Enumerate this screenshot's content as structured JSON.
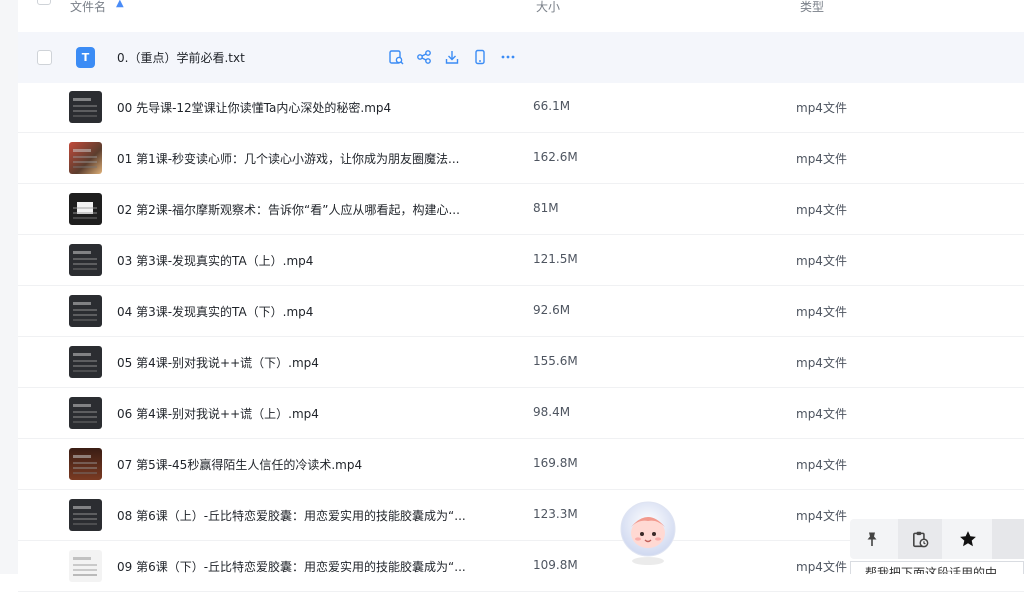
{
  "header": {
    "name_label": "文件名",
    "size_label": "大小",
    "type_label": "类型"
  },
  "highlighted_file": {
    "name": "0.（重点）学前必看.txt",
    "icon_letter": "T"
  },
  "rows": [
    {
      "name": "00 先导课-12堂课让你读懂Ta内心深处的秘密.mp4",
      "size": "66.1M",
      "type": "mp4文件"
    },
    {
      "name": "01 第1课-秒变读心师：几个读心小游戏，让你成为朋友圈魔法...",
      "size": "162.6M",
      "type": "mp4文件"
    },
    {
      "name": "02 第2课-福尔摩斯观察术：告诉你“看”人应从哪看起，构建心...",
      "size": "81M",
      "type": "mp4文件"
    },
    {
      "name": "03 第3课-发现真实的TA（上）.mp4",
      "size": "121.5M",
      "type": "mp4文件"
    },
    {
      "name": "04 第3课-发现真实的TA（下）.mp4",
      "size": "92.6M",
      "type": "mp4文件"
    },
    {
      "name": "05 第4课-别对我说++谎（下）.mp4",
      "size": "155.6M",
      "type": "mp4文件"
    },
    {
      "name": "06 第4课-别对我说++谎（上）.mp4",
      "size": "98.4M",
      "type": "mp4文件"
    },
    {
      "name": "07 第5课-45秒赢得陌生人信任的冷读术.mp4",
      "size": "169.8M",
      "type": "mp4文件"
    },
    {
      "name": "08 第6课（上）-丘比特恋爱胶囊：用恋爱实用的技能胶囊成为“...",
      "size": "123.3M",
      "type": "mp4文件"
    },
    {
      "name": "09 第6课（下）-丘比特恋爱胶囊：用恋爱实用的技能胶囊成为“...",
      "size": "109.8M",
      "type": "mp4文件"
    }
  ],
  "popup_text": "帮我把下面这段话用的中",
  "colors": {
    "accent": "#3b8cf5",
    "highlight_row": "#f4f6fb"
  }
}
